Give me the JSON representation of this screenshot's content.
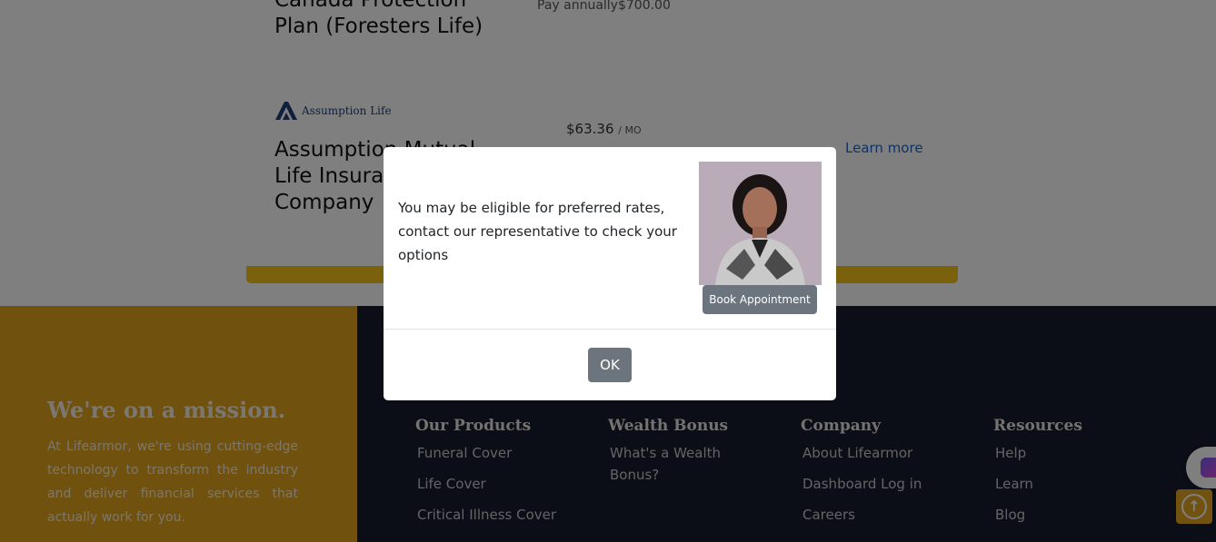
{
  "quotes": [
    {
      "title_line1": "Canada Protection",
      "title_line2": "Plan (Foresters Life)",
      "price_text": "Pay annually$700.00"
    },
    {
      "brand_logo_text": "Assumption Life",
      "title": "Assumption Mutual Life Insurance Company",
      "price": "$63.36",
      "price_unit": "/ MO",
      "link": "Learn more"
    }
  ],
  "footer": {
    "mission": {
      "title": "We're on a mission.",
      "text": "At Lifearmor, we're using cutting-edge technology to transform the industry and deliver financial services that actually work for you."
    },
    "columns": [
      {
        "heading": "Our Products",
        "links": [
          "Funeral Cover",
          "Life Cover",
          "Critical Illness Cover"
        ]
      },
      {
        "heading": "Wealth Bonus",
        "links": [
          "What's a Wealth Bonus?"
        ]
      },
      {
        "heading": "Company",
        "links": [
          "About Lifearmor",
          "Dashboard Log in",
          "Careers"
        ]
      },
      {
        "heading": "Resources",
        "links": [
          "Help",
          "Learn",
          "Blog"
        ]
      }
    ]
  },
  "modal": {
    "message": "You may be eligible for preferred rates, contact our representative to check your options",
    "book_button": "Book Appointment",
    "ok_button": "OK"
  },
  "icons": {
    "chat": "chat-widget-icon",
    "scroll_top": "arrow-up-circle-icon",
    "brand": "assumption-life-logo"
  },
  "colors": {
    "footer_gold": "#e1a21c",
    "footer_dark": "#171c2c",
    "accent_yellow": "#f5c518",
    "button_gray": "#6c757d",
    "link_blue": "#1a66c4"
  }
}
